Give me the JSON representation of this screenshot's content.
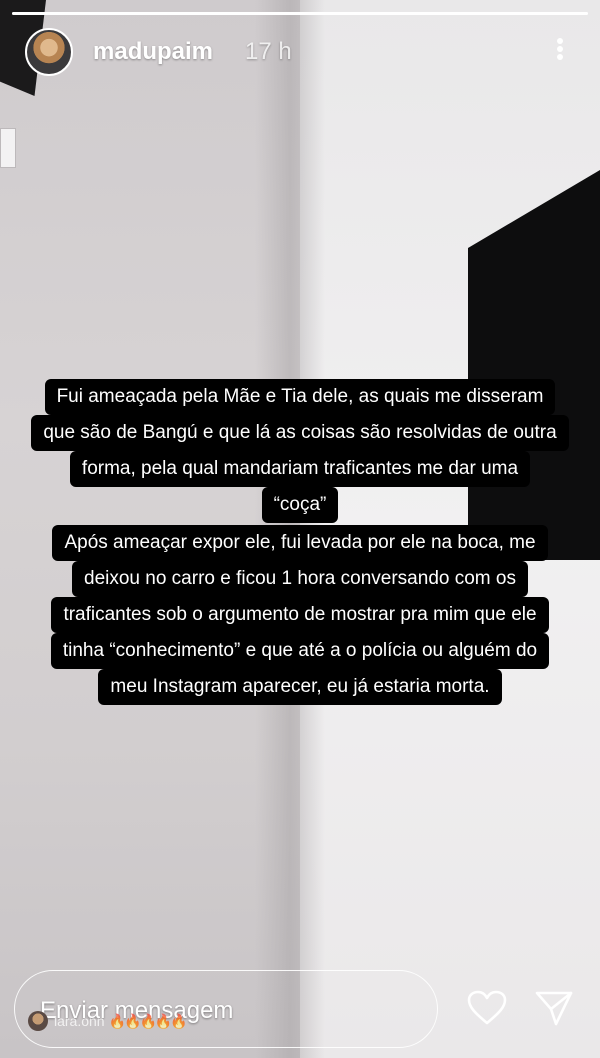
{
  "story": {
    "username": "madupaim",
    "timestamp": "17 h",
    "progress": 1.0
  },
  "captions": [
    {
      "lines": [
        "Fui ameaçada pela Mãe e Tia dele, as quais me disseram",
        "que são de Bangú e que lá as coisas são resolvidas de outra",
        "forma, pela qual mandariam traficantes me dar uma",
        "“coça”"
      ]
    },
    {
      "lines": [
        "Após ameaçar expor ele, fui levada por ele na boca, me",
        "deixou no carro e ficou 1 hora conversando com os",
        "traficantes sob o argumento de mostrar pra mim que ele",
        "tinha “conhecimento” e que até a o polícia ou alguém do",
        "meu Instagram aparecer, eu já estaria morta."
      ]
    }
  ],
  "footer": {
    "message_placeholder": "Enviar mensagem",
    "overlay_user": "lara.onn",
    "overlay_emojis": "🔥🔥🔥🔥🔥"
  },
  "icons": {
    "more": "more-vertical-icon",
    "like": "heart-icon",
    "send": "send-icon"
  },
  "colors": {
    "caption_bg": "#000000",
    "caption_text": "#ffffff",
    "header_text": "#ffffff"
  }
}
